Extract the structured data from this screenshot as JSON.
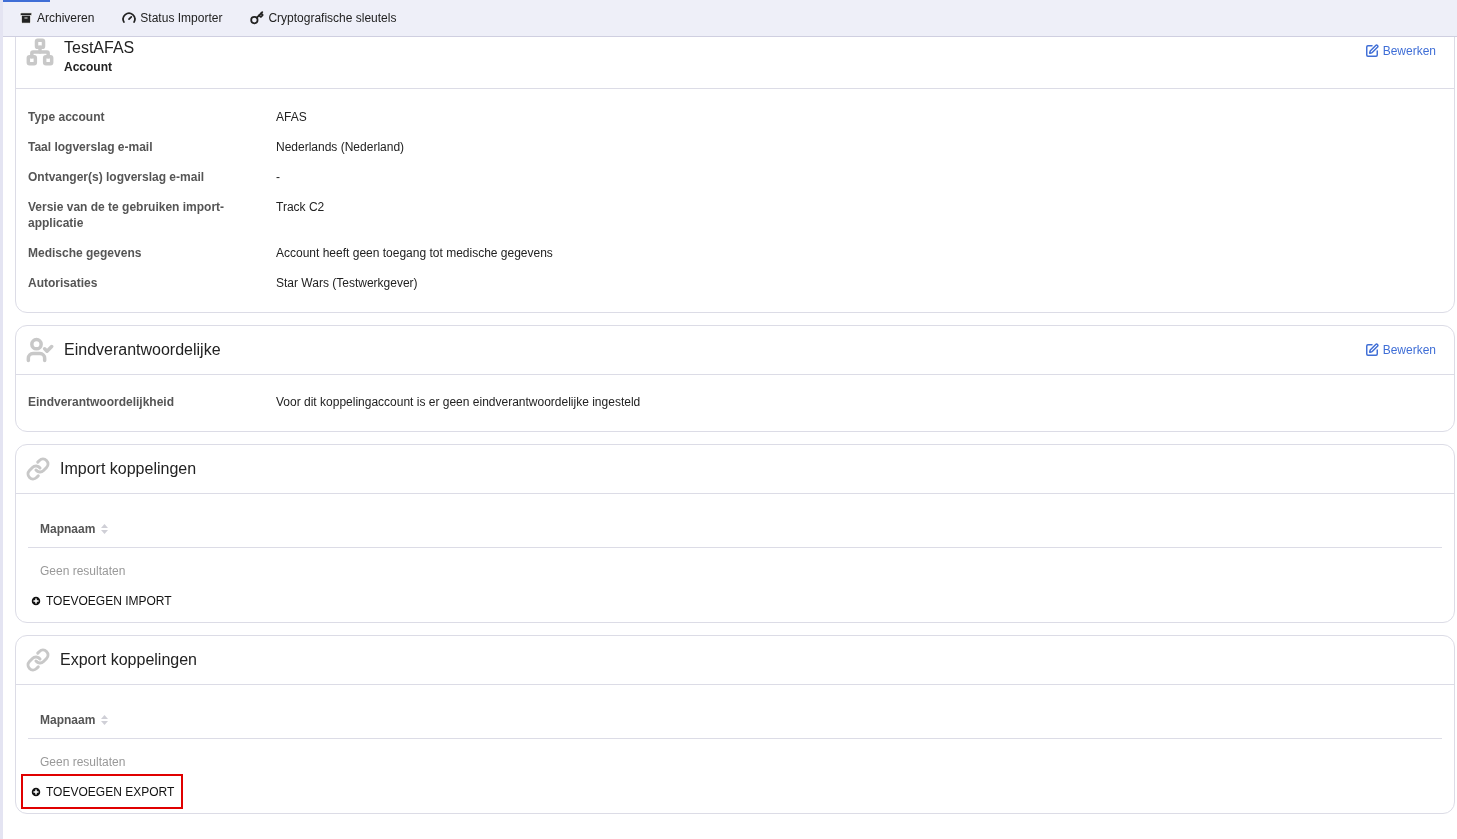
{
  "toolbar": [
    {
      "kind": "archive",
      "label": "Archiveren"
    },
    {
      "kind": "gauge",
      "label": "Status Importer"
    },
    {
      "kind": "key",
      "label": "Cryptografische sleutels"
    }
  ],
  "account_card": {
    "title": "TestAFAS",
    "subtitle": "Account",
    "edit": "Bewerken",
    "fields": [
      {
        "label": "Type account",
        "value": "AFAS"
      },
      {
        "label": "Taal logverslag e-mail",
        "value": "Nederlands (Nederland)"
      },
      {
        "label": "Ontvanger(s) logverslag e-mail",
        "value": "-"
      },
      {
        "label": "Versie van de te gebruiken import-applicatie",
        "value": "Track C2"
      },
      {
        "label": "Medische gegevens",
        "value": "Account heeft geen toegang tot medische gegevens"
      },
      {
        "label": "Autorisaties",
        "value": "Star Wars (Testwerkgever)"
      }
    ]
  },
  "responsible_card": {
    "title": "Eindverantwoordelijke",
    "edit": "Bewerken",
    "fields": [
      {
        "label": "Eindverantwoordelijkheid",
        "value": "Voor dit koppelingaccount is er geen eindverantwoordelijke ingesteld"
      }
    ]
  },
  "link_cards": [
    {
      "title": "Import koppelingen",
      "column": "Mapnaam",
      "empty": "Geen resultaten",
      "add": "TOEVOEGEN IMPORT",
      "highlighted": false
    },
    {
      "title": "Export koppelingen",
      "column": "Mapnaam",
      "empty": "Geen resultaten",
      "add": "TOEVOEGEN EXPORT",
      "highlighted": true
    }
  ]
}
